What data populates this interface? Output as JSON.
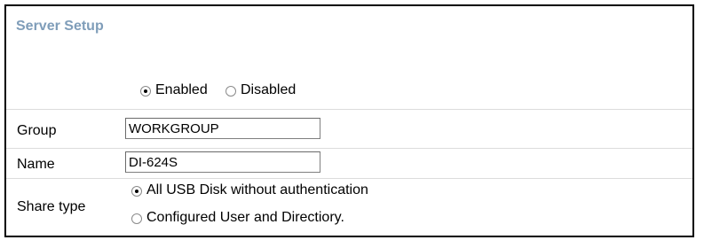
{
  "section": {
    "title": "Server Setup"
  },
  "server_status": {
    "options": [
      "Enabled",
      "Disabled"
    ],
    "selected": "Enabled"
  },
  "group": {
    "label": "Group",
    "value": "WORKGROUP"
  },
  "name": {
    "label": "Name",
    "value": "DI-624S"
  },
  "share_type": {
    "label": "Share type",
    "options": [
      "All USB Disk without authentication",
      "Configured User and Directiory."
    ],
    "selected": "All USB Disk without authentication"
  }
}
